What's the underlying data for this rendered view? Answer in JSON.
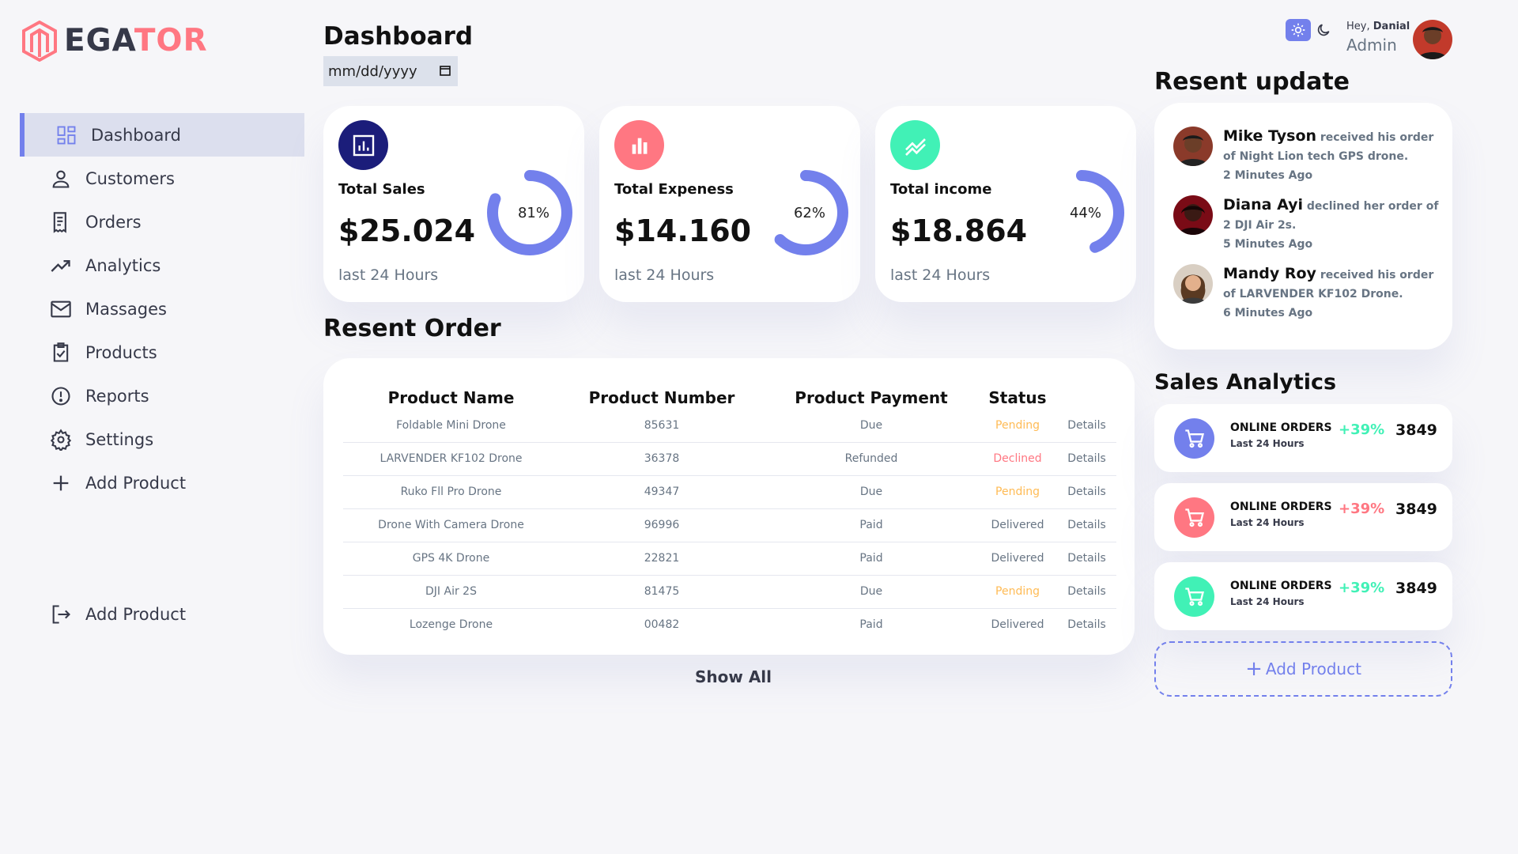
{
  "brand": {
    "part1": "EGA",
    "part2": "TOR"
  },
  "sidebar": {
    "items": [
      {
        "label": "Dashboard",
        "icon": "grid-icon",
        "active": true
      },
      {
        "label": "Customers",
        "icon": "person-icon"
      },
      {
        "label": "Orders",
        "icon": "receipt-icon"
      },
      {
        "label": "Analytics",
        "icon": "trending-icon"
      },
      {
        "label": "Massages",
        "icon": "mail-icon"
      },
      {
        "label": "Products",
        "icon": "inventory-icon"
      },
      {
        "label": "Reports",
        "icon": "alert-icon"
      },
      {
        "label": "Settings",
        "icon": "gear-icon"
      },
      {
        "label": "Add Product",
        "icon": "plus-icon"
      }
    ],
    "logout_label": "Add Product"
  },
  "header": {
    "title": "Dashboard",
    "date_placeholder": "mm/dd/yyyy"
  },
  "cards": [
    {
      "label": "Total Sales",
      "value": "$25.024",
      "sub": "last 24 Hours",
      "percent": 81,
      "percent_label": "81%",
      "color": "#1b1d7a",
      "icon": "chart-icon"
    },
    {
      "label": "Total Expeness",
      "value": "$14.160",
      "sub": "last 24 Hours",
      "percent": 62,
      "percent_label": "62%",
      "color": "#ff7782",
      "icon": "bar-chart-icon"
    },
    {
      "label": "Total income",
      "value": "$18.864",
      "sub": "last 24 Hours",
      "percent": 44,
      "percent_label": "44%",
      "color": "#41f1b6",
      "icon": "trend-icon"
    }
  ],
  "orders": {
    "title": "Resent Order",
    "headers": [
      "Product Name",
      "Product Number",
      "Product Payment",
      "Status"
    ],
    "rows": [
      {
        "name": "Foldable Mini Drone",
        "number": "85631",
        "payment": "Due",
        "status": "Pending",
        "details": "Details"
      },
      {
        "name": "LARVENDER KF102 Drone",
        "number": "36378",
        "payment": "Refunded",
        "status": "Declined",
        "details": "Details"
      },
      {
        "name": "Ruko Fll Pro Drone",
        "number": "49347",
        "payment": "Due",
        "status": "Pending",
        "details": "Details"
      },
      {
        "name": "Drone With Camera Drone",
        "number": "96996",
        "payment": "Paid",
        "status": "Delivered",
        "details": "Details"
      },
      {
        "name": "GPS 4K Drone",
        "number": "22821",
        "payment": "Paid",
        "status": "Delivered",
        "details": "Details"
      },
      {
        "name": "DJI Air 2S",
        "number": "81475",
        "payment": "Due",
        "status": "Pending",
        "details": "Details"
      },
      {
        "name": "Lozenge Drone",
        "number": "00482",
        "payment": "Paid",
        "status": "Delivered",
        "details": "Details"
      }
    ],
    "show_all": "Show All"
  },
  "profile": {
    "hey": "Hey,",
    "name": "Danial",
    "role": "Admin"
  },
  "updates": {
    "title": "Resent update",
    "items": [
      {
        "name": "Mike Tyson",
        "message": "received his order of Night Lion tech GPS drone.",
        "time": "2 Minutes Ago"
      },
      {
        "name": "Diana Ayi",
        "message": "declined her order of 2 DJI Air 2s.",
        "time": "5 Minutes Ago"
      },
      {
        "name": "Mandy Roy",
        "message": "received his order of LARVENDER KF102 Drone.",
        "time": "6 Minutes Ago"
      }
    ]
  },
  "sales_analytics": {
    "title": "Sales Analytics",
    "items": [
      {
        "title": "ONLINE ORDERS",
        "sub": "Last 24 Hours",
        "percent": "+39%",
        "value": "3849",
        "icon_color": "#7380ec",
        "percent_color": "#41f1b6"
      },
      {
        "title": "ONLINE ORDERS",
        "sub": "Last 24 Hours",
        "percent": "+39%",
        "value": "3849",
        "icon_color": "#ff7782",
        "percent_color": "#ff7782"
      },
      {
        "title": "ONLINE ORDERS",
        "sub": "Last 24 Hours",
        "percent": "+39%",
        "value": "3849",
        "icon_color": "#41f1b6",
        "percent_color": "#41f1b6"
      }
    ],
    "add_product": "Add Product"
  },
  "colors": {
    "primary": "#7380ec",
    "danger": "#ff7782",
    "success": "#41f1b6",
    "warning": "#ffbb55"
  }
}
